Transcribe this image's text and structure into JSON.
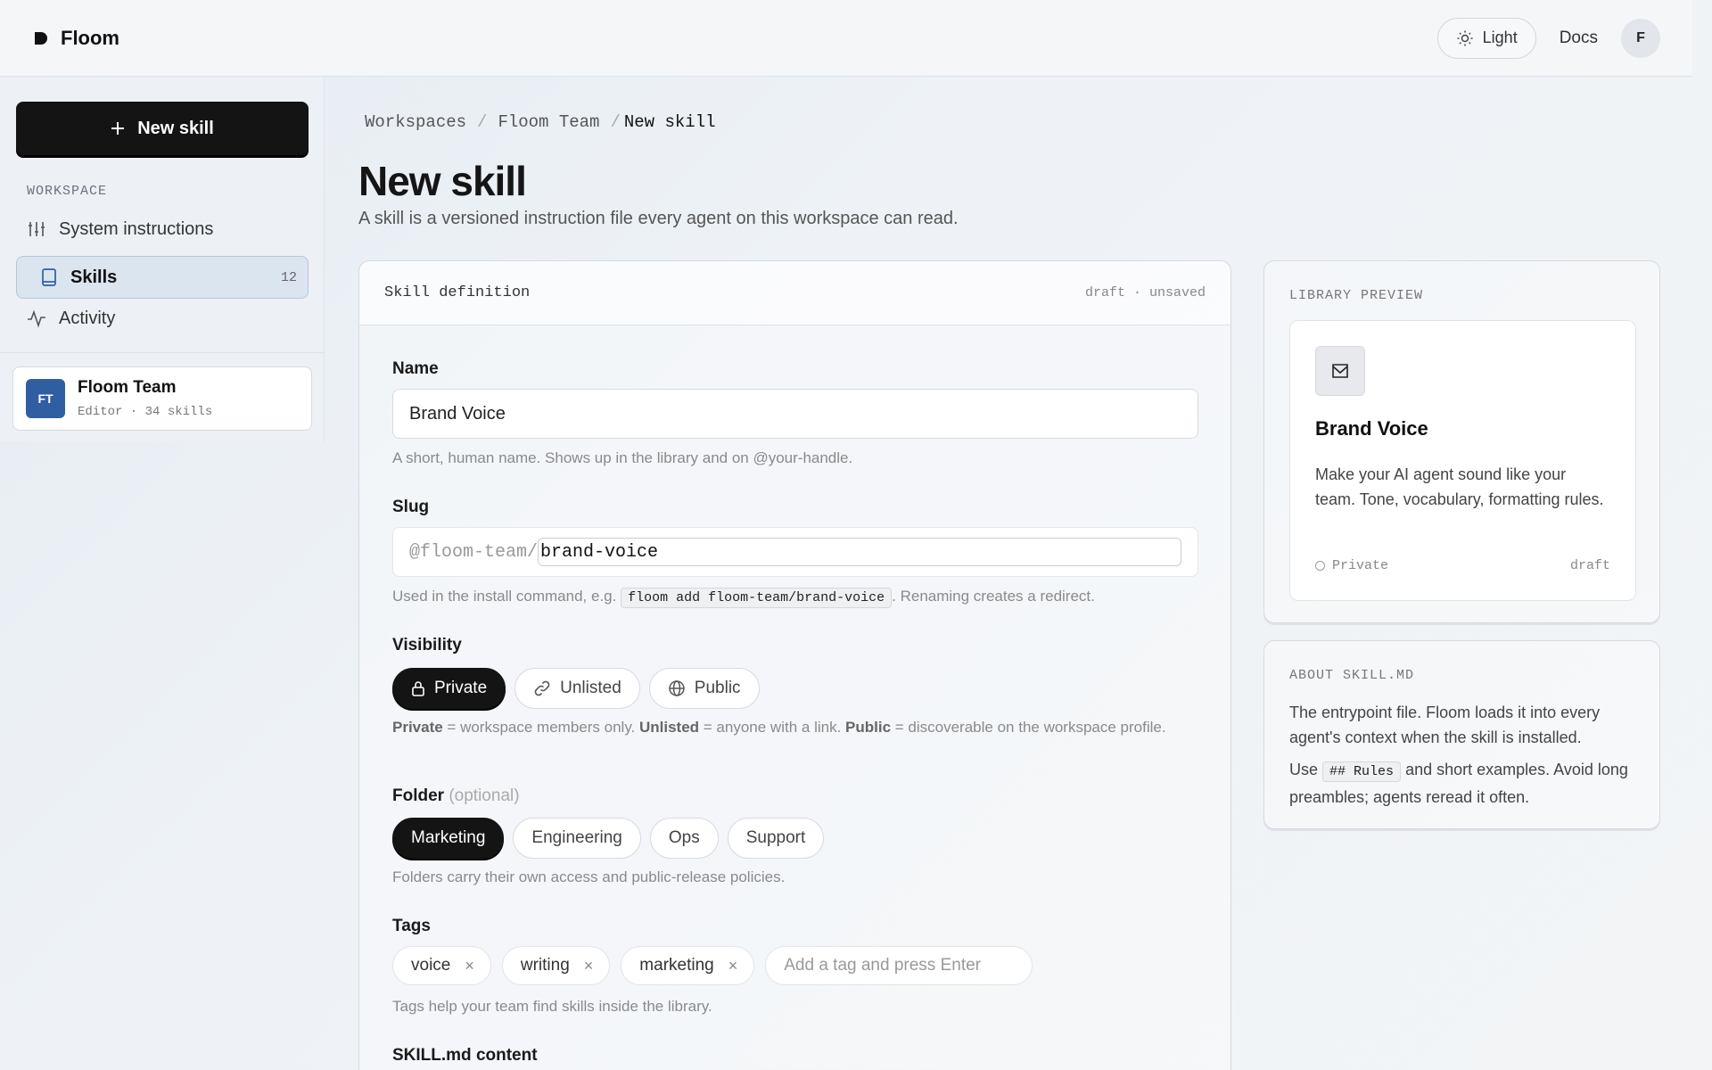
{
  "header": {
    "brand": "Floom",
    "theme_label": "Light",
    "docs_label": "Docs",
    "avatar_initial": "F"
  },
  "sidebar": {
    "new_skill_label": "New skill",
    "section_label": "WORKSPACE",
    "items": [
      {
        "label": "System instructions",
        "icon": "sliders-icon"
      },
      {
        "label": "Skills",
        "icon": "book-icon",
        "count": "12",
        "active": true
      },
      {
        "label": "Activity",
        "icon": "activity-icon"
      }
    ],
    "team": {
      "initials": "FT",
      "name": "Floom Team",
      "meta": "Editor · 34 skills"
    }
  },
  "breadcrumb": {
    "items": [
      "Workspaces",
      "Floom Team"
    ],
    "separator": "/",
    "current": "New skill"
  },
  "page": {
    "title": "New skill",
    "subtitle": "A skill is a versioned instruction file every agent on this workspace can read."
  },
  "form": {
    "card_title": "Skill definition",
    "status": "draft · unsaved",
    "name": {
      "label": "Name",
      "value": "Brand Voice",
      "help": "A short, human name. Shows up in the library and on @your-handle."
    },
    "slug": {
      "label": "Slug",
      "prefix": "@floom-team/",
      "value": "brand-voice",
      "help_before": "Used in the install command, e.g.",
      "help_code": "floom add floom-team/brand-voice",
      "help_after": ". Renaming creates a redirect."
    },
    "visibility": {
      "label": "Visibility",
      "options": [
        {
          "label": "Private",
          "icon": "lock-icon",
          "selected": true
        },
        {
          "label": "Unlisted",
          "icon": "link-icon",
          "selected": false
        },
        {
          "label": "Public",
          "icon": "globe-icon",
          "selected": false
        }
      ],
      "help_private": "Private",
      "help_private_desc": " = workspace members only. ",
      "help_unlisted": "Unlisted",
      "help_unlisted_desc": " = anyone with a link. ",
      "help_public": "Public",
      "help_public_desc": " = discoverable on the workspace profile."
    },
    "folder": {
      "label": "Folder",
      "optional": "(optional)",
      "options": [
        {
          "label": "Marketing",
          "selected": true
        },
        {
          "label": "Engineering",
          "selected": false
        },
        {
          "label": "Ops",
          "selected": false
        },
        {
          "label": "Support",
          "selected": false
        }
      ],
      "help": "Folders carry their own access and public-release policies."
    },
    "tags": {
      "label": "Tags",
      "items": [
        "voice",
        "writing",
        "marketing"
      ],
      "remove_glyph": "×",
      "placeholder": "Add a tag and press Enter",
      "help": "Tags help your team find skills inside the library."
    },
    "content_label": "SKILL.md content"
  },
  "preview": {
    "label": "LIBRARY PREVIEW",
    "name": "Brand Voice",
    "description": "Make your AI agent sound like your team. Tone, vocabulary, formatting rules.",
    "visibility": "Private",
    "status": "draft"
  },
  "about": {
    "label": "ABOUT SKILL.MD",
    "text1": "The entrypoint file. Floom loads it into every agent's context when the skill is installed.",
    "text2_before": "Use",
    "text2_code": "## Rules",
    "text2_after": "and short examples. Avoid long preambles; agents reread it often."
  }
}
